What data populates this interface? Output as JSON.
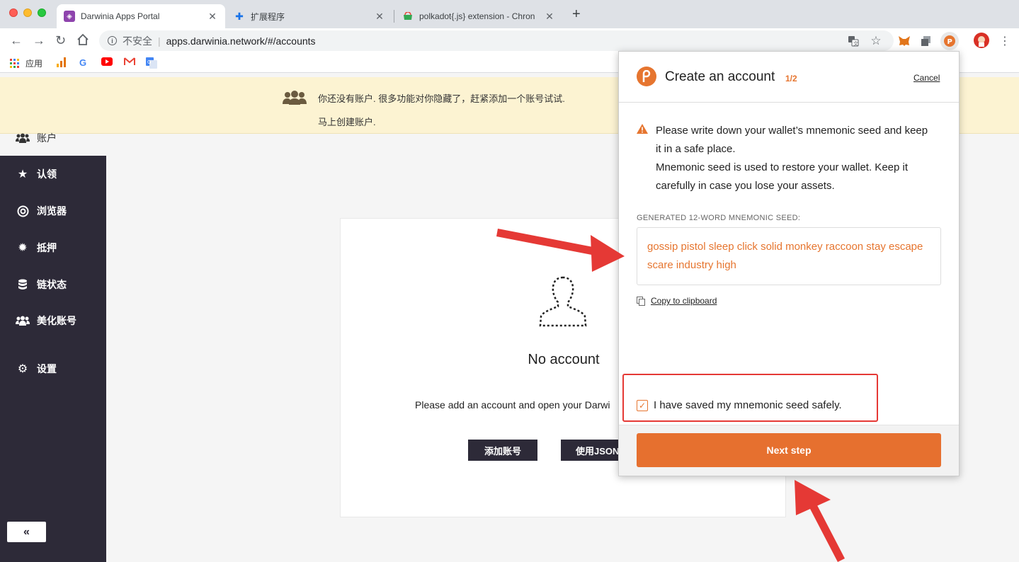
{
  "browser": {
    "tabs": [
      {
        "title": "Darwinia Apps Portal",
        "favicon": "darwinia-favicon"
      },
      {
        "title": "扩展程序",
        "favicon": "puzzle-icon"
      },
      {
        "title": "polkadot{.js} extension - Chron",
        "favicon": "webstore-icon"
      }
    ],
    "new_tab": "+",
    "address": {
      "security": "不安全",
      "url": "apps.darwinia.network/#/accounts"
    },
    "bookmarks": {
      "apps_label": "应用"
    }
  },
  "banner": {
    "message": "你还没有账户. 很多功能对你隐藏了，赶紧添加一个账号试试.",
    "create_link": "马上创建账户."
  },
  "sidebar": {
    "top_item": "账户",
    "items": [
      {
        "label": "认领",
        "icon": "star-icon"
      },
      {
        "label": "浏览器",
        "icon": "target-icon"
      },
      {
        "label": "抵押",
        "icon": "gear-burst-icon"
      },
      {
        "label": "链状态",
        "icon": "database-icon"
      },
      {
        "label": "美化账号",
        "icon": "users-icon"
      },
      {
        "label": "设置",
        "icon": "cogs-icon"
      }
    ],
    "collapse": "«"
  },
  "main": {
    "no_account_title": "No account",
    "hint": "Please add an account and open your Darwi",
    "add_button": "添加账号",
    "json_button": "使用JSON"
  },
  "popup": {
    "title": "Create an account",
    "step": "1/2",
    "cancel": "Cancel",
    "warning_line1": "Please write down your wallet’s mnemonic seed and keep it in a safe place.",
    "warning_line2": "Mnemonic seed is used to restore your wallet. Keep it carefully in case you lose your assets.",
    "seed_label": "GENERATED 12-WORD MNEMONIC SEED:",
    "seed": "gossip pistol sleep click solid monkey raccoon stay escape scare industry high",
    "copy": "Copy to clipboard",
    "checkbox_label": "I have saved my mnemonic seed safely.",
    "checkbox_checked": true,
    "next": "Next step",
    "accent": "#e6752f"
  },
  "colors": {
    "sidebar_bg": "#2d2a38",
    "banner_bg": "#fcf3d2",
    "annotation_red": "#e53935"
  }
}
